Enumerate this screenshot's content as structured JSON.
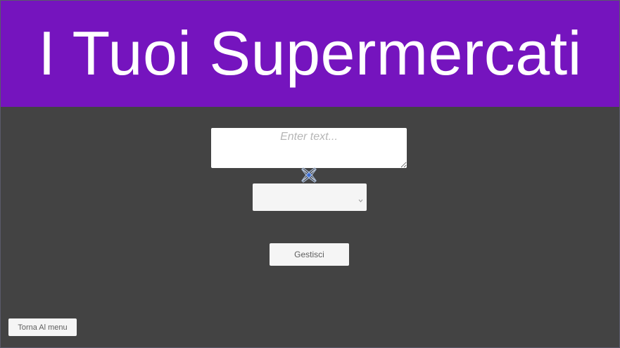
{
  "header": {
    "title": "I Tuoi Supermercati",
    "background_color": "#7514be"
  },
  "search": {
    "placeholder": "Enter text...",
    "value": ""
  },
  "dropdown": {
    "selected": "",
    "arrow_icon": "chevron-down-icon"
  },
  "gizmo": {
    "icon": "unity-event-system-icon"
  },
  "actions": {
    "manage_label": "Gestisci",
    "back_label": "Torna Al menu"
  },
  "colors": {
    "background": "#434343",
    "button": "#f5f5f5",
    "input": "#ffffff"
  }
}
